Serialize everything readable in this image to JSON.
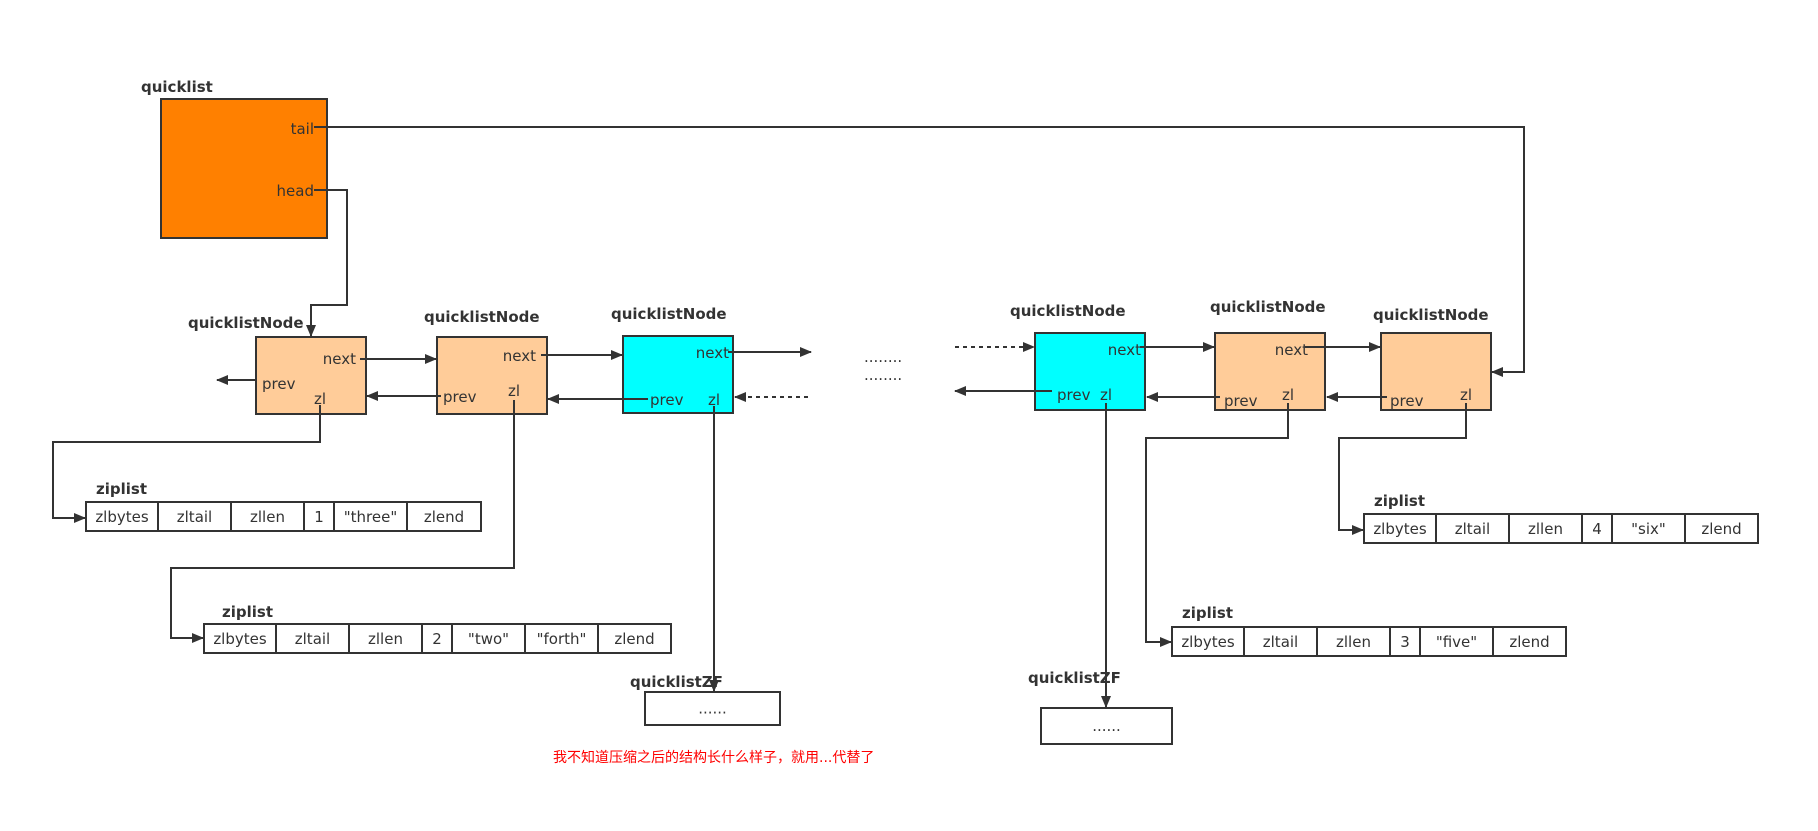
{
  "colors": {
    "quicklist_fill": "#ff8000",
    "node_fill": "#ffcc99",
    "compressed_fill": "#00ffff",
    "stroke": "#333333",
    "note": "#ff0000"
  },
  "quicklist": {
    "label": "quicklist",
    "tail": "tail",
    "head": "head"
  },
  "nodes": [
    {
      "label": "quicklistNode",
      "next": "next",
      "prev": "prev",
      "zl": "zl",
      "compressed": false
    },
    {
      "label": "quicklistNode",
      "next": "next",
      "prev": "prev",
      "zl": "zl",
      "compressed": false
    },
    {
      "label": "quicklistNode",
      "next": "next",
      "prev": "prev",
      "zl": "zl",
      "compressed": true
    },
    {
      "label": "quicklistNode",
      "next": "next",
      "prev": "prev",
      "zl": "zl",
      "compressed": true
    },
    {
      "label": "quicklistNode",
      "next": "next",
      "prev": "prev",
      "zl": "zl",
      "compressed": false
    },
    {
      "label": "quicklistNode",
      "next": "",
      "prev": "prev",
      "zl": "zl",
      "compressed": false
    }
  ],
  "ziplists": [
    {
      "label": "ziplist",
      "cells": [
        "zlbytes",
        "zltail",
        "zllen",
        "1",
        "\"three\"",
        "zlend"
      ]
    },
    {
      "label": "ziplist",
      "cells": [
        "zlbytes",
        "zltail",
        "zllen",
        "2",
        "\"two\"",
        "\"forth\"",
        "zlend"
      ]
    },
    {
      "label": "ziplist",
      "cells": [
        "zlbytes",
        "zltail",
        "zllen",
        "3",
        "\"five\"",
        "zlend"
      ]
    },
    {
      "label": "ziplist",
      "cells": [
        "zlbytes",
        "zltail",
        "zllen",
        "4",
        "\"six\"",
        "zlend"
      ]
    }
  ],
  "compressed": [
    {
      "label": "quicklistZF",
      "content": "......"
    },
    {
      "label": "quicklistZF",
      "content": "......"
    }
  ],
  "ellipsis": [
    "........",
    "........"
  ],
  "note": "我不知道压缩之后的结构长什么样子，就用...代替了"
}
